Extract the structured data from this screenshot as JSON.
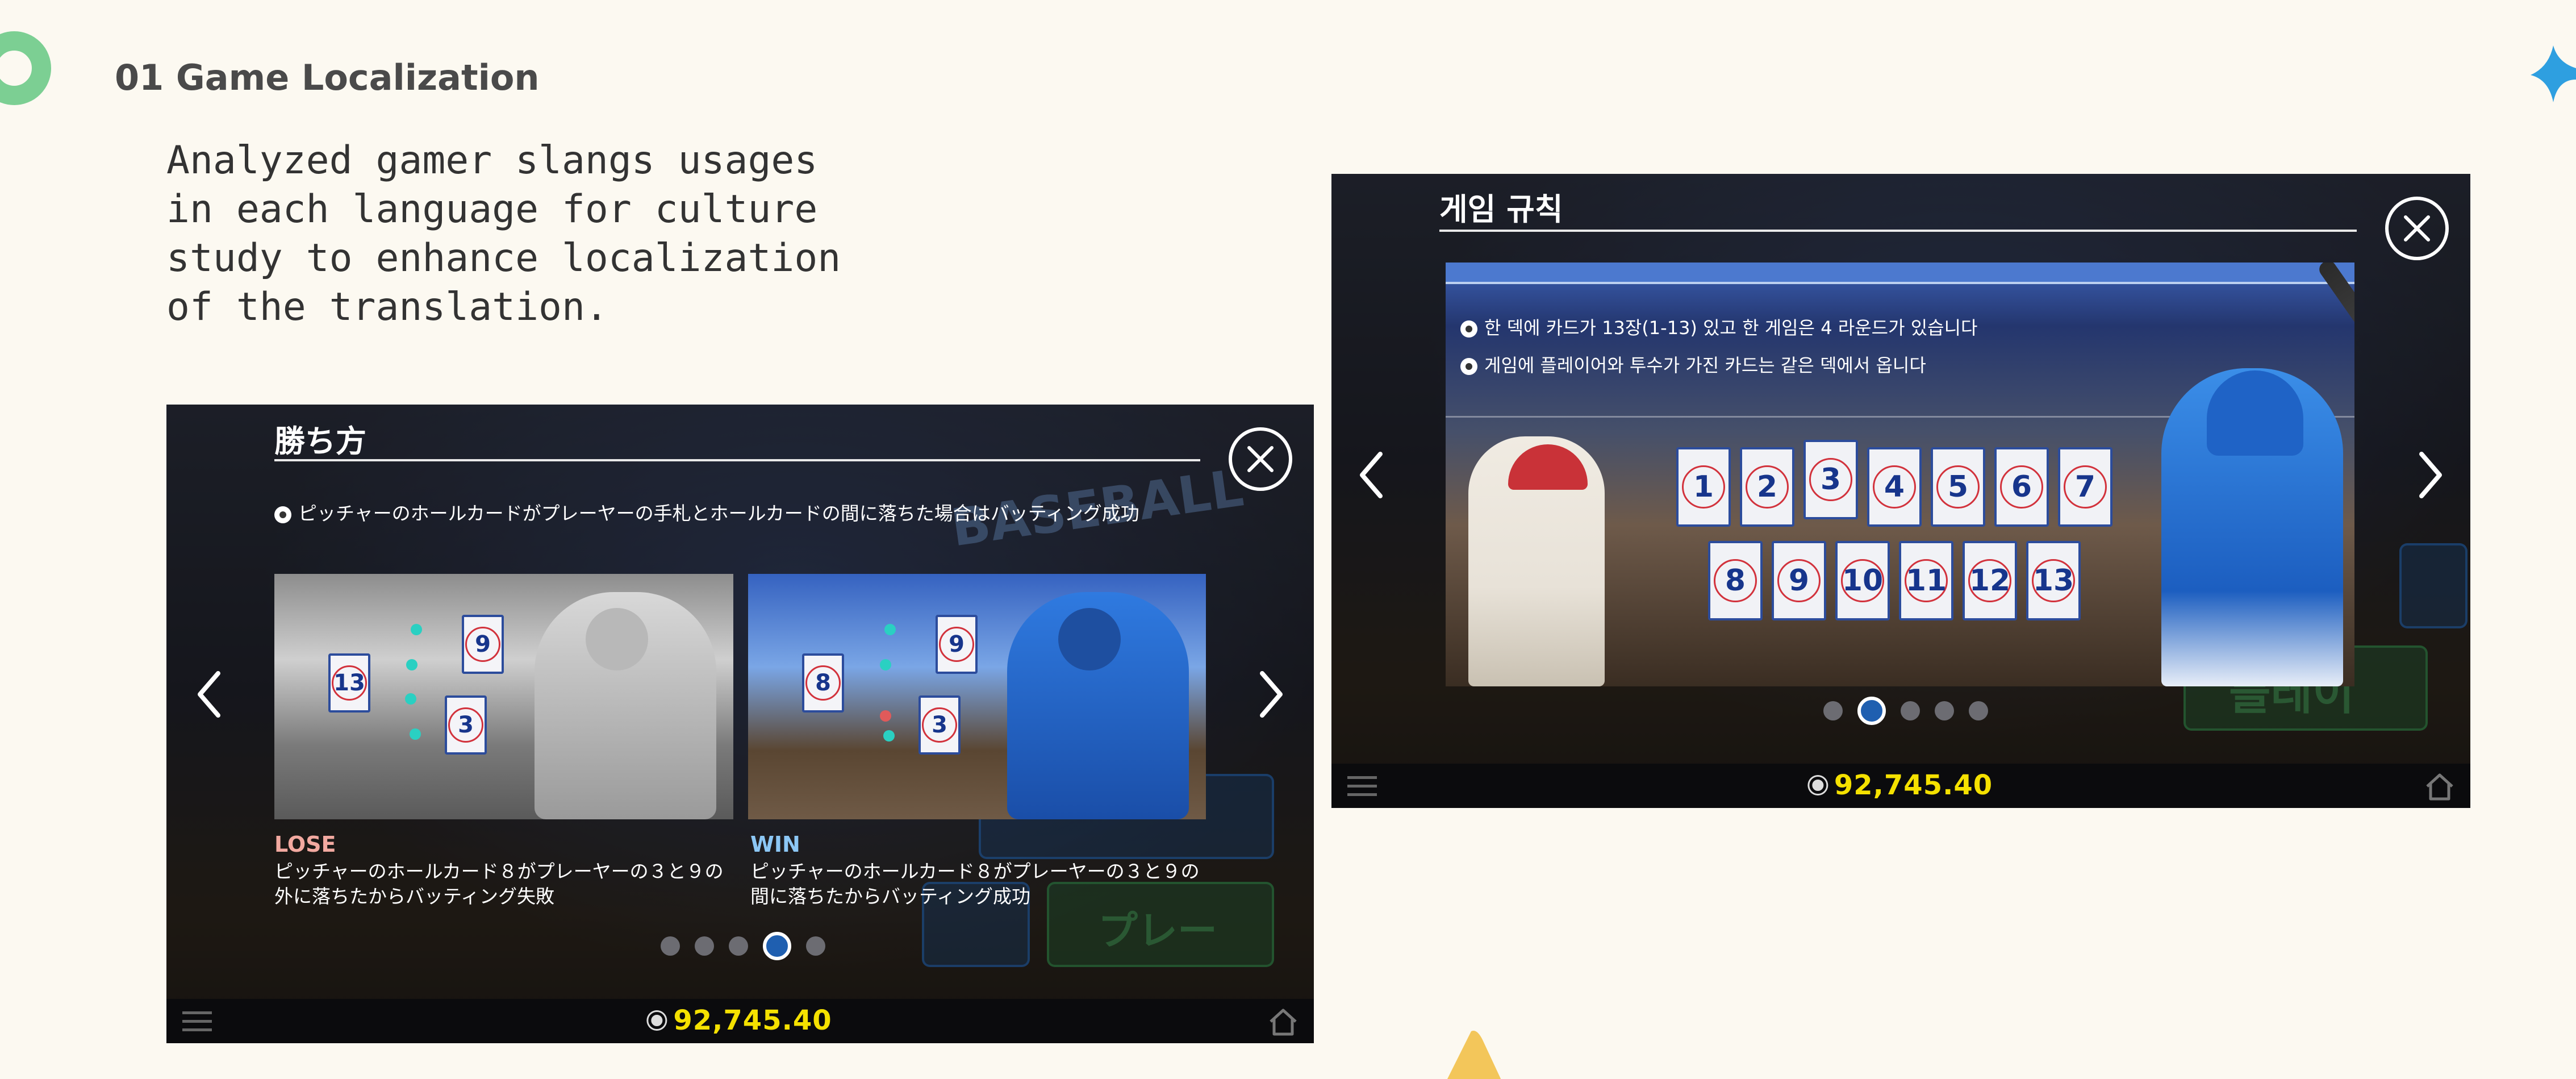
{
  "section": {
    "heading": "01 Game Localization",
    "description": "Analyzed gamer slangs usages\nin each language for culture\nstudy to enhance localization\nof the translation."
  },
  "panel_jp": {
    "title": "勝ち方",
    "rule": "ピッチャーのホールカードがプレーヤーの手札とホールカードの間に落ちた場合はバッティング成功",
    "ghost_logo": "BASEBALL",
    "ghost_play": "プレー",
    "lose": {
      "label": "LOSE",
      "text": "ピッチャーのホールカード８がプレーヤーの３と９の\n外に落ちたからバッティング失敗",
      "cards": [
        "13",
        "9",
        "3"
      ]
    },
    "win": {
      "label": "WIN",
      "text": "ピッチャーのホールカード８がプレーヤーの３と９の\n間に落ちたからバッティング成功",
      "cards": [
        "8",
        "9",
        "3"
      ]
    },
    "pagination": {
      "count": 5,
      "active_index": 3
    },
    "balance": "92,745.40"
  },
  "panel_kr": {
    "title": "게임 규칙",
    "rules": [
      "한 덱에 카드가 13장(1-13) 있고 한 게임은 4 라운드가 있습니다",
      "게임에 플레이어와 투수가 가진 카드는 같은 덱에서 옵니다"
    ],
    "ghost_play": "플레이",
    "cards_row1": [
      "1",
      "2",
      "3",
      "4",
      "5",
      "6",
      "7"
    ],
    "cards_row2": [
      "8",
      "9",
      "10",
      "11",
      "12",
      "13"
    ],
    "pagination": {
      "count": 5,
      "active_index": 1
    },
    "balance": "92,745.40"
  },
  "colors": {
    "background": "#fcf9f1",
    "lose": "#f2a9a0",
    "win": "#8cc7f5",
    "balance": "#f5e100",
    "ring_deco": "#7ccf93",
    "cross_deco": "#2e9fe0",
    "triangle_deco": "#f3c65a"
  },
  "icons": [
    "close-icon",
    "chevron-left-icon",
    "chevron-right-icon",
    "menu-icon",
    "home-icon",
    "coin-icon"
  ]
}
